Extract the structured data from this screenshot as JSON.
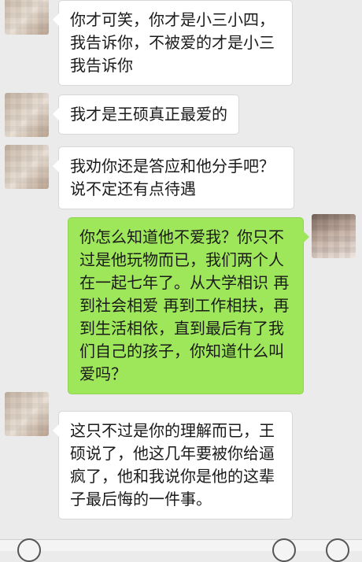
{
  "messages": [
    {
      "side": "other",
      "lines": [
        "你才可笑，你才是小三小四，",
        "我告诉你，不被爱的才是小三",
        "我告诉你"
      ]
    },
    {
      "side": "other",
      "lines": [
        "我才是王硕真正最爱的"
      ]
    },
    {
      "side": "other",
      "lines": [
        "我劝你还是答应和他分手吧？",
        "说不定还有点待遇"
      ]
    },
    {
      "side": "me",
      "lines": [
        "你怎么知道他不爱我？你只不",
        "过是他玩物而已，我们两个人",
        "在一起七年了。从大学相识 再",
        "到社会相爱 再到工作相扶，再",
        "到生活相依，直到最后有了我",
        "们自己的孩子，你知道什么叫",
        "爱吗？"
      ]
    },
    {
      "side": "other",
      "lines": [
        "这只不过是你的理解而已，王",
        "硕说了，他这几年要被你给逼",
        "疯了，他和我说你是他的这辈",
        "子最后悔的一件事。"
      ]
    }
  ],
  "bottom_bar": {
    "icons": [
      "voice-icon",
      "emoji-icon",
      "plus-icon"
    ]
  }
}
